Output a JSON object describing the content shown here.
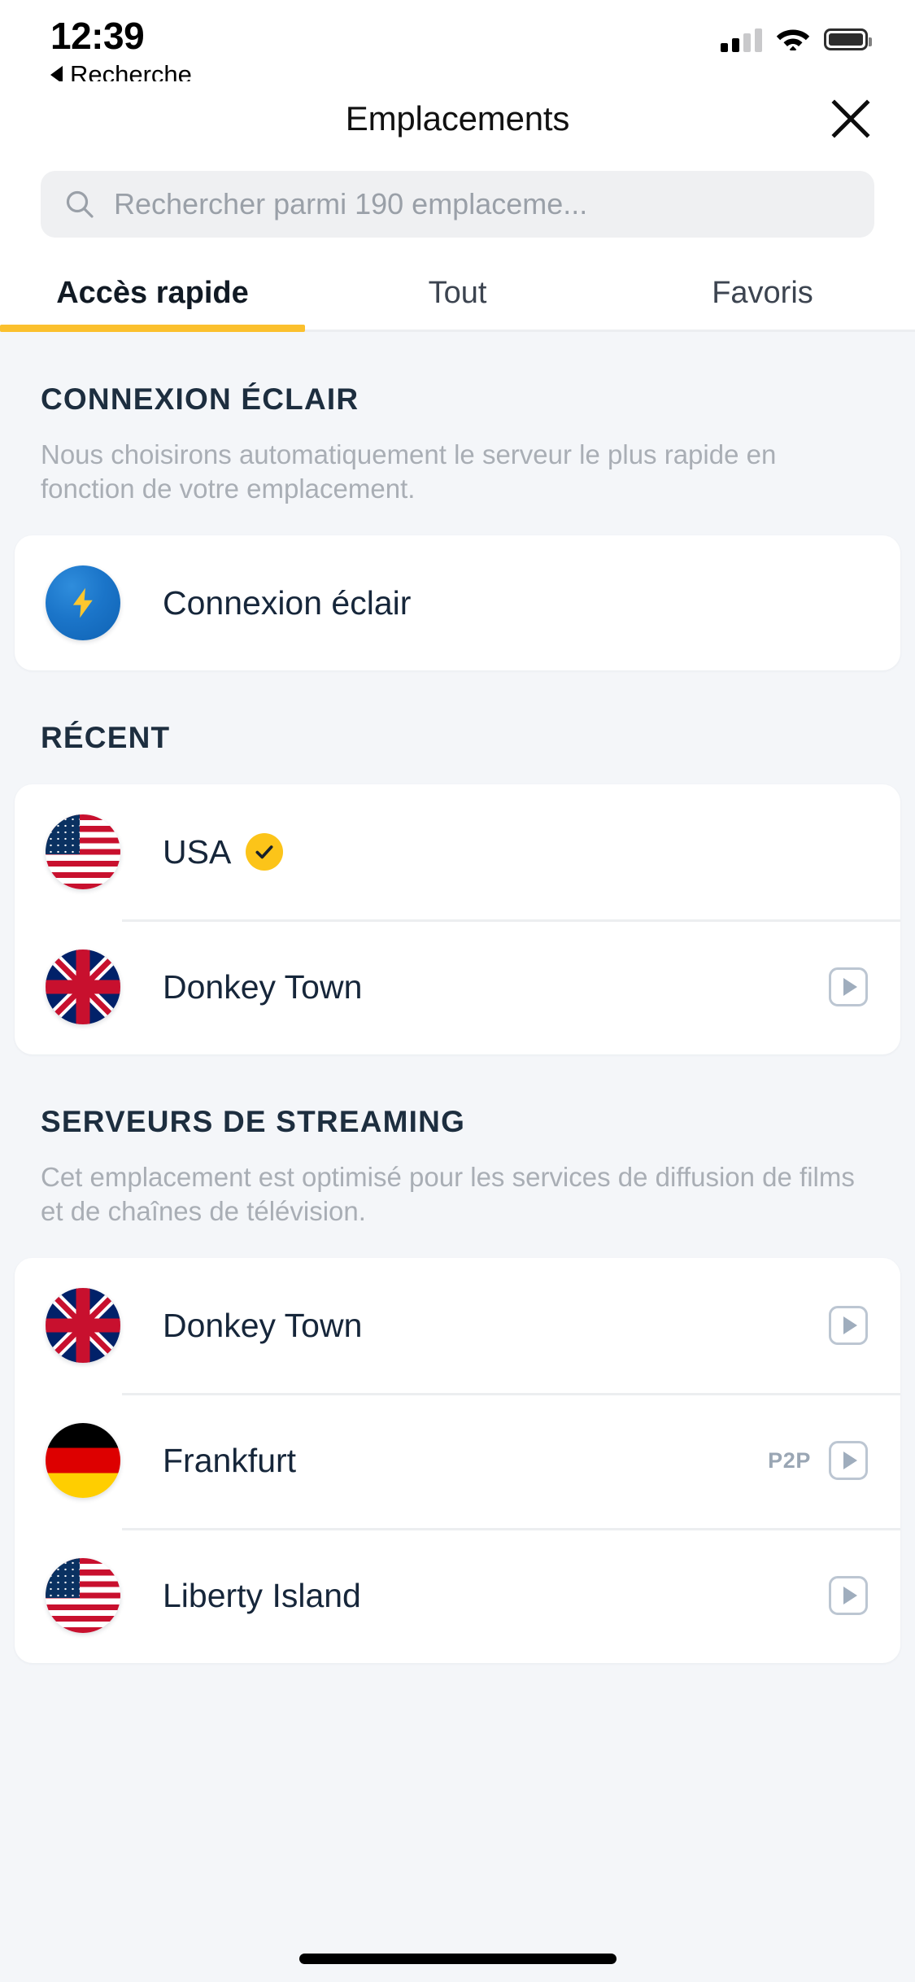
{
  "status_bar": {
    "time": "12:39",
    "back_label": "Recherche",
    "signal_icon": "cellular-signal-icon",
    "wifi_icon": "wifi-icon",
    "battery_icon": "battery-full-icon"
  },
  "header": {
    "title": "Emplacements",
    "close_icon": "close-icon"
  },
  "search": {
    "placeholder": "Rechercher parmi 190 emplaceme...",
    "value": "",
    "icon": "search-icon"
  },
  "tabs": [
    {
      "label": "Accès rapide",
      "active": true
    },
    {
      "label": "Tout",
      "active": false
    },
    {
      "label": "Favoris",
      "active": false
    }
  ],
  "colors": {
    "accent_yellow": "#fbc02d",
    "badge_yellow": "#fcc419",
    "heading_navy": "#1d2e3f",
    "muted_gray": "#a9aeb5",
    "page_bg": "#f4f6f9",
    "card_bg": "#ffffff",
    "bolt_blue": "#1b75c9"
  },
  "sections": [
    {
      "title": "CONNEXION ÉCLAIR",
      "description": "Nous choisirons automatiquement le serveur le plus rapide en fonction de votre emplacement.",
      "rows": [
        {
          "label": "Connexion éclair",
          "icon": "lightning-bolt-icon",
          "flag": "none",
          "selected": false,
          "tag": "",
          "stream": false
        }
      ]
    },
    {
      "title": "RÉCENT",
      "description": "",
      "rows": [
        {
          "label": "USA",
          "icon": "flag-icon",
          "flag": "us",
          "selected": true,
          "tag": "",
          "stream": false
        },
        {
          "label": "Donkey Town",
          "icon": "flag-icon",
          "flag": "uk",
          "selected": false,
          "tag": "",
          "stream": true
        }
      ]
    },
    {
      "title": "SERVEURS DE STREAMING",
      "description": "Cet emplacement est optimisé pour les services de diffusion de films et de chaînes de télévision.",
      "rows": [
        {
          "label": "Donkey Town",
          "icon": "flag-icon",
          "flag": "uk",
          "selected": false,
          "tag": "",
          "stream": true
        },
        {
          "label": "Frankfurt",
          "icon": "flag-icon",
          "flag": "de",
          "selected": false,
          "tag": "P2P",
          "stream": true
        },
        {
          "label": "Liberty Island",
          "icon": "flag-icon",
          "flag": "us",
          "selected": false,
          "tag": "",
          "stream": true
        }
      ]
    }
  ]
}
